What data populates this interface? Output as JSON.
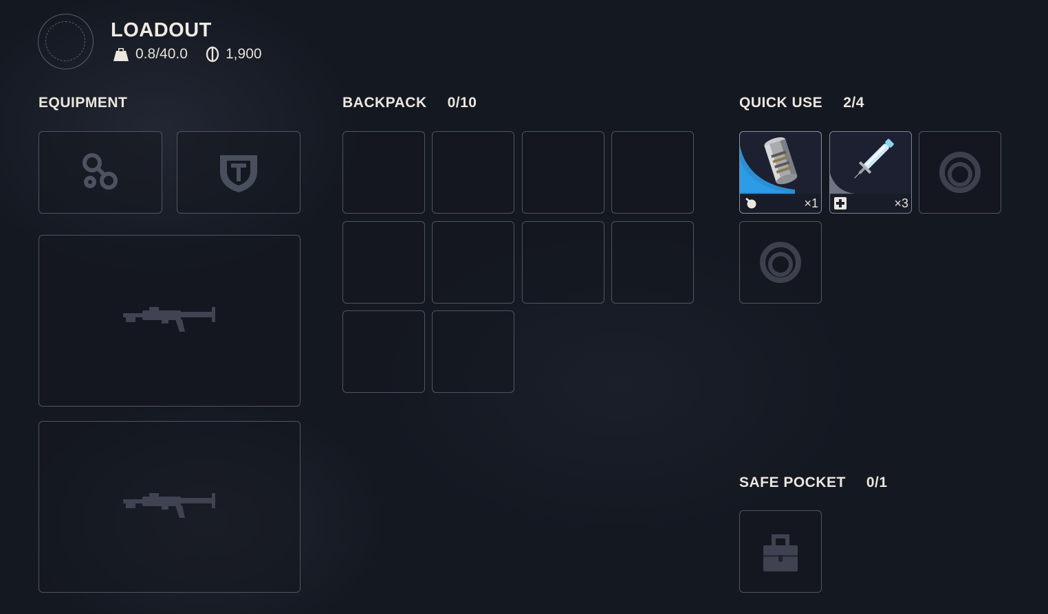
{
  "header": {
    "title": "LOADOUT",
    "weight": "0.8/40.0",
    "coins": "1,900"
  },
  "equipment": {
    "title": "EQUIPMENT",
    "slots": [
      {
        "icon": "augment-icon"
      },
      {
        "icon": "shield-icon"
      },
      {
        "icon": "rifle-icon"
      },
      {
        "icon": "rifle-icon"
      }
    ]
  },
  "backpack": {
    "title": "BACKPACK",
    "count": "0/10",
    "slots": 10
  },
  "quick_use": {
    "title": "QUICK USE",
    "count": "2/4",
    "items": [
      {
        "icon": "grenade-canister-icon",
        "type_icon": "grenade-hand-icon",
        "qty": "×1",
        "accent": "#2f9be8"
      },
      {
        "icon": "syringe-icon",
        "type_icon": "medical-plus-icon",
        "qty": "×3",
        "accent": "#6f7481"
      },
      {
        "icon": "empty-ring-icon"
      },
      {
        "icon": "empty-ring-icon"
      }
    ]
  },
  "safe_pocket": {
    "title": "SAFE POCKET",
    "count": "0/1",
    "icon": "lock-icon"
  },
  "colors": {
    "background": "#141821",
    "slot_border": "#4f5563",
    "text": "#ece7de",
    "quick_use_accent": "#2f9be8"
  }
}
